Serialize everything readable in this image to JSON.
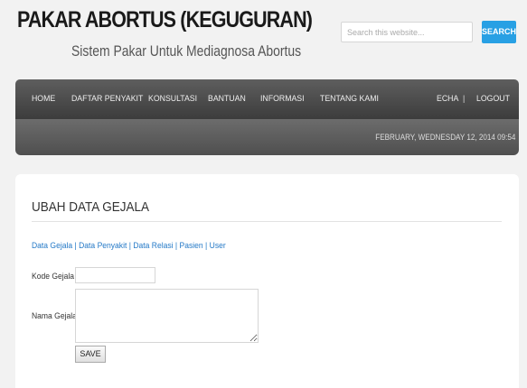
{
  "header": {
    "title": "PAKAR ABORTUS (KEGUGURAN)",
    "subtitle": "Sistem Pakar Untuk Mediagnosa Abortus"
  },
  "search": {
    "placeholder": "Search this website...",
    "button_label": "SEARCH",
    "accent_color": "#28a0e4"
  },
  "nav": {
    "items": [
      "HOME",
      "DAFTAR PENYAKIT",
      "KONSULTASI",
      "BANTUAN",
      "INFORMASI",
      "TENTANG KAMI"
    ],
    "user": "ECHA",
    "separator": "|",
    "logout": "LOGOUT"
  },
  "datebar": {
    "text": "FEBRUARY, WEDNESDAY 12, 2014 09:54"
  },
  "content": {
    "title": "UBAH DATA GEJALA",
    "links": [
      "Data Gejala",
      "Data Penyakit",
      "Data Relasi",
      "Pasien",
      "User"
    ],
    "link_separator": "|",
    "form": {
      "kode_label": "Kode Gejala",
      "kode_value": "",
      "nama_label": "Nama Gejala",
      "nama_value": "",
      "save_label": "SAVE"
    }
  }
}
